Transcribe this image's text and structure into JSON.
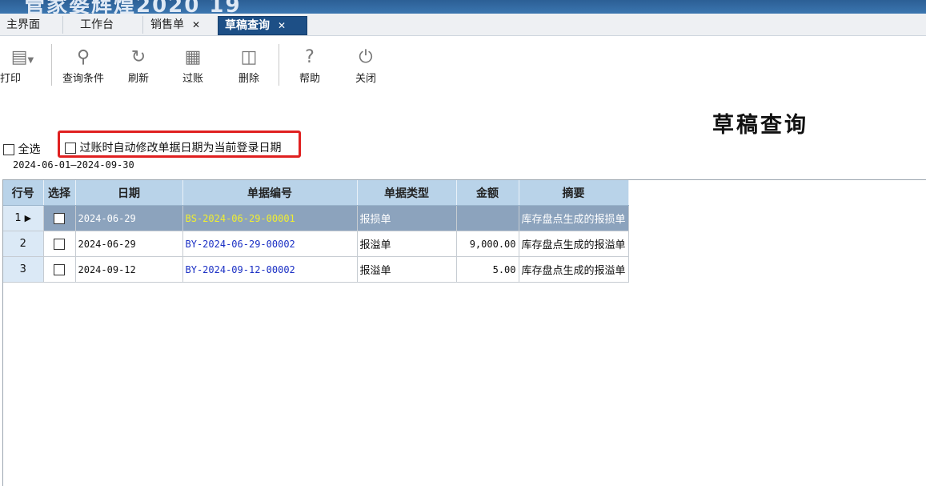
{
  "banner": {
    "text": "管家婆辉煌2020 19"
  },
  "tabs": [
    {
      "label": "主界面",
      "closable": false,
      "active": false
    },
    {
      "label": "工作台",
      "closable": false,
      "active": false
    },
    {
      "label": "销售单",
      "closable": true,
      "active": false
    },
    {
      "label": "草稿查询",
      "closable": true,
      "active": true
    }
  ],
  "toolbar": {
    "print": {
      "label": "打印",
      "icon": "printer-icon"
    },
    "query": {
      "label": "查询条件",
      "icon": "search-icon"
    },
    "refresh": {
      "label": "刷新",
      "icon": "refresh-icon"
    },
    "post": {
      "label": "过账",
      "icon": "post-icon"
    },
    "delete": {
      "label": "删除",
      "icon": "trash-icon"
    },
    "help": {
      "label": "帮助",
      "icon": "help-icon"
    },
    "close": {
      "label": "关闭",
      "icon": "power-icon"
    }
  },
  "page": {
    "title": "草稿查询"
  },
  "options": {
    "select_all": "全选",
    "auto_date": "过账时自动修改单据日期为当前登录日期",
    "date_range": "2024-06-01—2024-09-30"
  },
  "grid": {
    "columns": [
      "行号",
      "选择",
      "日期",
      "单据编号",
      "单据类型",
      "金额",
      "摘要"
    ],
    "rows": [
      {
        "no": "1",
        "date": "2024-06-29",
        "code": "BS-2024-06-29-00001",
        "type": "报损单",
        "amount": "",
        "summary": "库存盘点生成的报损单",
        "selected": true
      },
      {
        "no": "2",
        "date": "2024-06-29",
        "code": "BY-2024-06-29-00002",
        "type": "报溢单",
        "amount": "9,000.00",
        "summary": "库存盘点生成的报溢单",
        "selected": false
      },
      {
        "no": "3",
        "date": "2024-09-12",
        "code": "BY-2024-09-12-00002",
        "type": "报溢单",
        "amount": "5.00",
        "summary": "库存盘点生成的报溢单",
        "selected": false
      }
    ]
  },
  "colors": {
    "tab_active": "#1d4f86",
    "header_bg": "#b9d3e9",
    "selected_row": "#8ca3bd",
    "code_link": "#1a2fc4",
    "highlight_box": "#e02020"
  }
}
